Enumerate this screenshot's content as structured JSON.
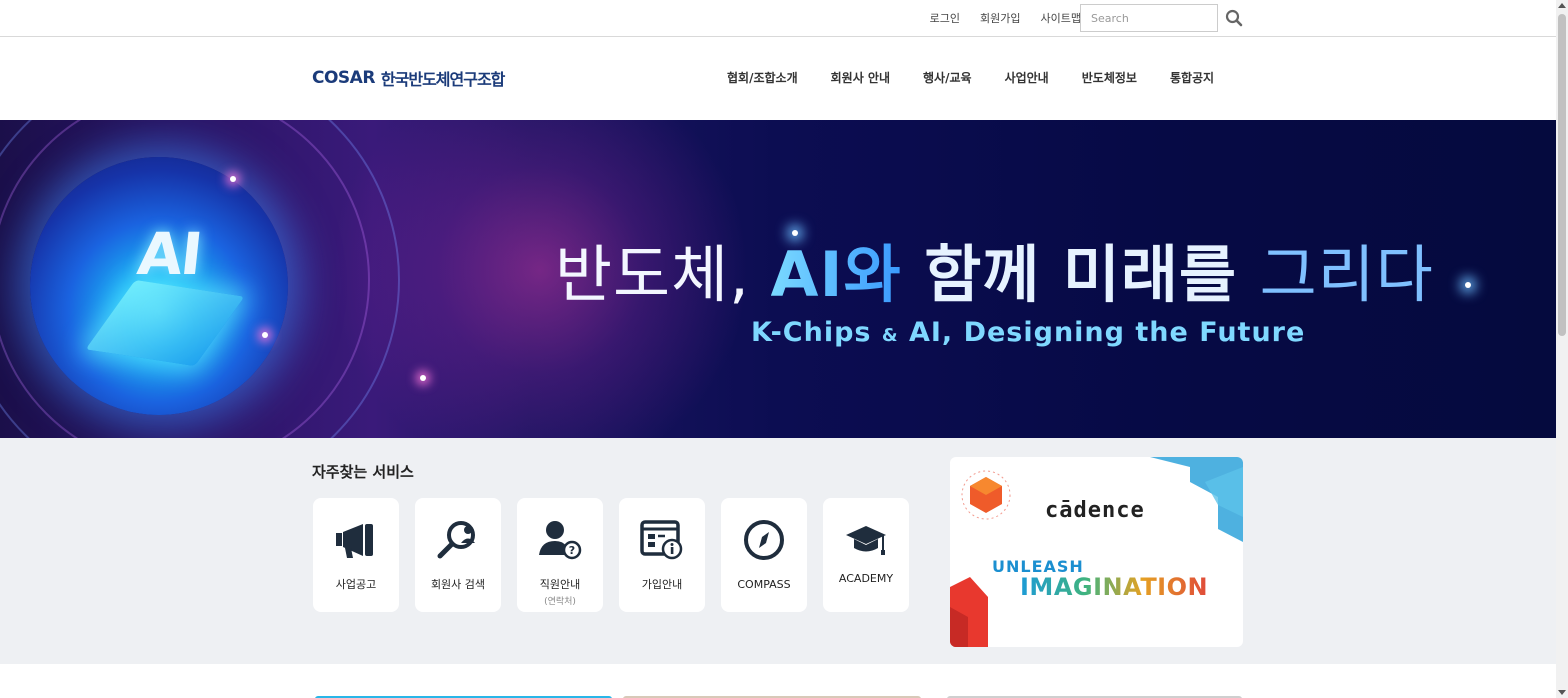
{
  "util": {
    "links": [
      "로그인",
      "회원가입",
      "사이트맵"
    ],
    "search_placeholder": "Search",
    "search_icon": "search-icon"
  },
  "header": {
    "logo_mark": "COSAR",
    "logo_text": "한국반도체연구조합",
    "nav": [
      "협회/조합소개",
      "회원사 안내",
      "행사/교육",
      "사업안내",
      "반도체정보",
      "통합공지"
    ]
  },
  "banner": {
    "orb_text": "AI",
    "title_part1": "반도체, ",
    "title_part2": "AI와 ",
    "title_part3": "함께 미래를 ",
    "title_part4": "그리다",
    "subtitle_a": "K-Chips ",
    "subtitle_amp": "&",
    "subtitle_b": " AI, Designing the Future"
  },
  "services": {
    "title": "자주찾는 서비스",
    "items": [
      {
        "label": "사업공고",
        "sub": "",
        "icon": "megaphone-icon"
      },
      {
        "label": "회원사 검색",
        "sub": "",
        "icon": "member-search-icon"
      },
      {
        "label": "직원안내",
        "sub": "(연락처)",
        "icon": "staff-info-icon"
      },
      {
        "label": "가입안내",
        "sub": "",
        "icon": "join-info-icon"
      },
      {
        "label": "COMPASS",
        "sub": "",
        "icon": "compass-icon"
      },
      {
        "label": "ACADEMY",
        "sub": "",
        "icon": "graduation-cap-icon"
      }
    ]
  },
  "ad": {
    "brand": "cādence",
    "line1": "UNLEASH",
    "line2": "IMAGINATION"
  },
  "colors": {
    "brand_navy": "#1b3b7a",
    "icon_dark": "#1f2d3d",
    "band_bg": "#eef0f3",
    "banner_bg": "#060a45"
  }
}
